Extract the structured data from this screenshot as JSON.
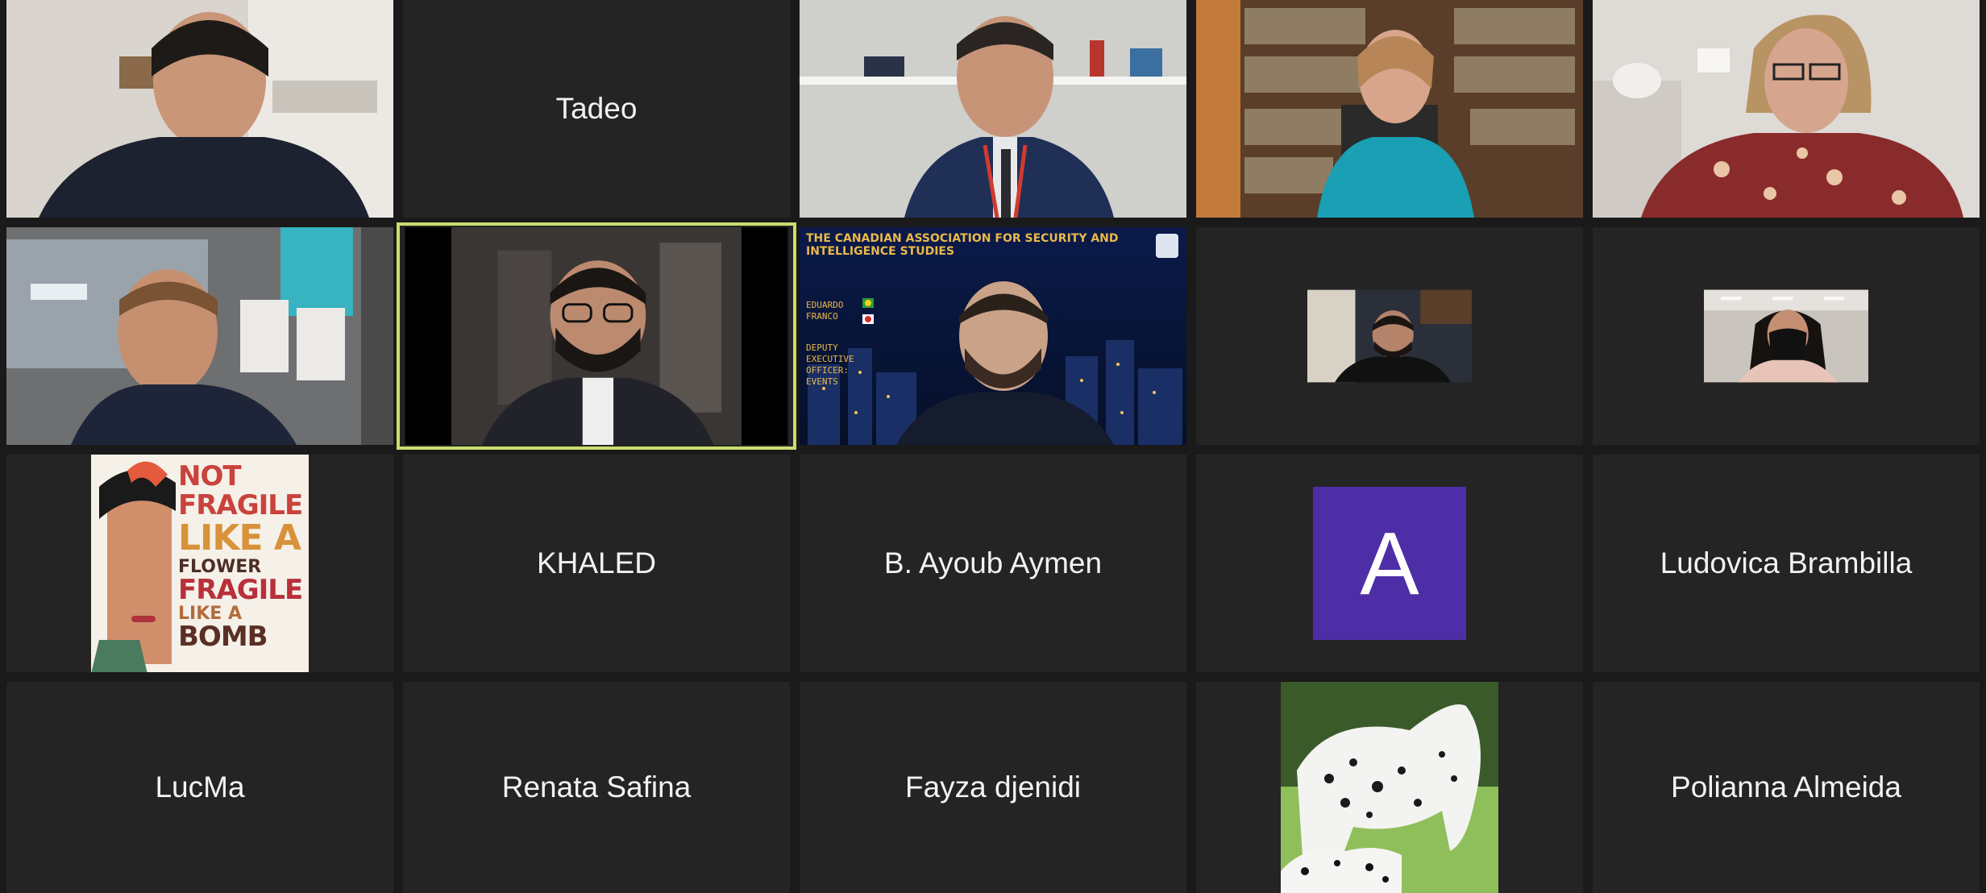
{
  "app": {
    "name": "Video meeting — gallery view"
  },
  "participants": [
    {
      "id": "p1",
      "display": "video",
      "description": "man in dark shirt, white room"
    },
    {
      "id": "p2",
      "display": "name",
      "name": "Tadeo"
    },
    {
      "id": "p3",
      "display": "video",
      "description": "man in suit, office shelves"
    },
    {
      "id": "p4",
      "display": "video",
      "description": "woman in teal shirt, bookshelf"
    },
    {
      "id": "p5",
      "display": "video",
      "description": "woman with glasses, patterned top"
    },
    {
      "id": "p6",
      "display": "video",
      "description": "man at office desk"
    },
    {
      "id": "p7",
      "display": "video",
      "description": "bearded man with glasses, active speaker",
      "active_speaker": true
    },
    {
      "id": "p8",
      "display": "video",
      "description": "man with virtual city background",
      "banner_title": "THE CANADIAN ASSOCIATION FOR SECURITY AND INTELLIGENCE STUDIES",
      "banner_name": "EDUARDO FRANCO",
      "banner_role": "DEPUTY EXECUTIVE OFFICER: EVENTS"
    },
    {
      "id": "p9",
      "display": "video",
      "description": "man in dark room"
    },
    {
      "id": "p10",
      "display": "video",
      "description": "woman wearing mask"
    },
    {
      "id": "p11",
      "display": "image",
      "poster_lines": [
        "NOT",
        "FRAGILE",
        "LIKE A",
        "FLOWER",
        "FRAGILE",
        "LIKE A",
        "BOMB"
      ]
    },
    {
      "id": "p12",
      "display": "name",
      "name": "KHALED"
    },
    {
      "id": "p13",
      "display": "name",
      "name": "B. Ayoub Aymen"
    },
    {
      "id": "p14",
      "display": "avatar",
      "initial": "A",
      "color": "#4d2ea7"
    },
    {
      "id": "p15",
      "display": "name",
      "name": "Ludovica Brambilla"
    },
    {
      "id": "p16",
      "display": "name",
      "name": "LucMa"
    },
    {
      "id": "p17",
      "display": "name",
      "name": "Renata Safina"
    },
    {
      "id": "p18",
      "display": "name",
      "name": "Fayza djenidi"
    },
    {
      "id": "p19",
      "display": "image",
      "description": "spotted horse and dalmatian dog"
    },
    {
      "id": "p20",
      "display": "name",
      "name": "Polianna Almeida"
    }
  ],
  "colors": {
    "background": "#1a1a1a",
    "tile": "#242424",
    "active_border": "#c8df6e",
    "name_text": "#f2f2f2"
  }
}
